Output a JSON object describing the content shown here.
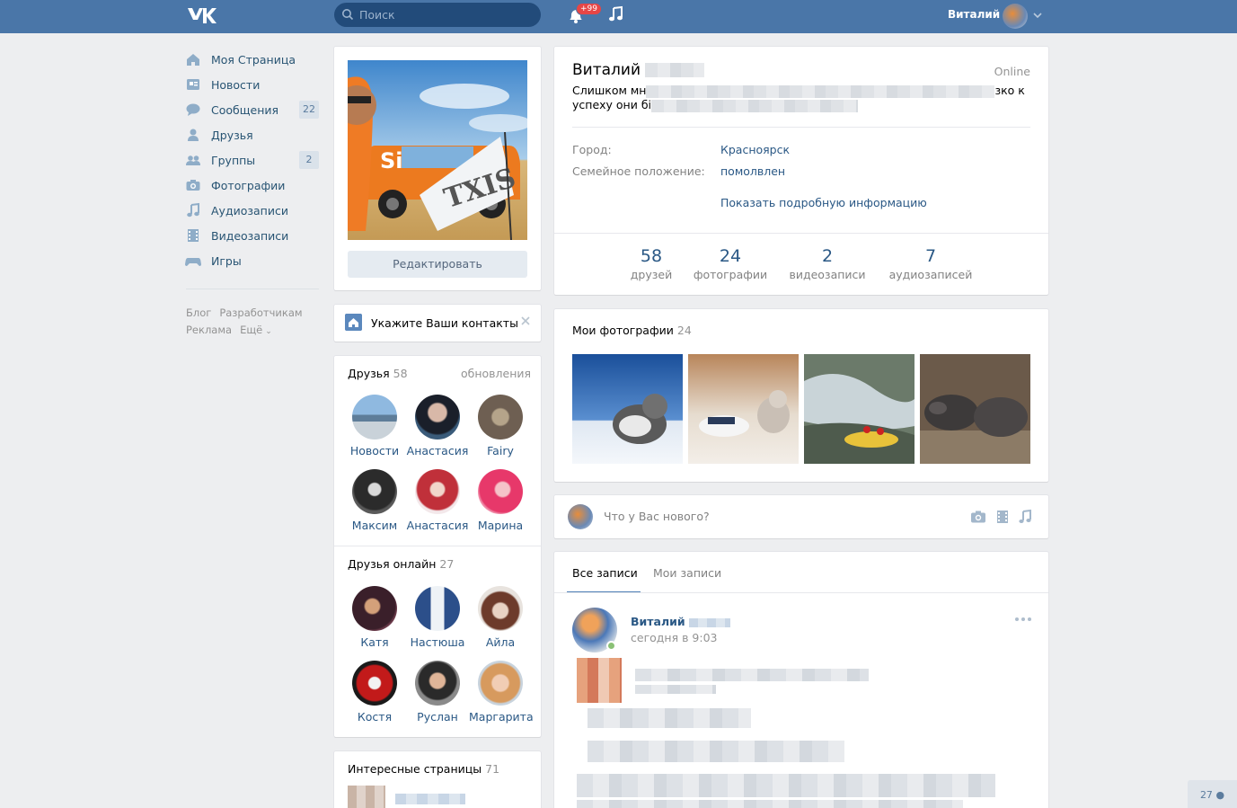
{
  "header": {
    "search_placeholder": "Поиск",
    "notifications_badge": "+99",
    "user_name": "Виталий"
  },
  "sidebar": {
    "items": [
      {
        "label": "Моя Страница",
        "icon": "home-icon",
        "count": ""
      },
      {
        "label": "Новости",
        "icon": "news-icon",
        "count": ""
      },
      {
        "label": "Сообщения",
        "icon": "messages-icon",
        "count": "22"
      },
      {
        "label": "Друзья",
        "icon": "friend-icon",
        "count": ""
      },
      {
        "label": "Группы",
        "icon": "groups-icon",
        "count": "2"
      },
      {
        "label": "Фотографии",
        "icon": "camera-icon",
        "count": ""
      },
      {
        "label": "Аудиозаписи",
        "icon": "music-icon",
        "count": ""
      },
      {
        "label": "Видеозаписи",
        "icon": "film-icon",
        "count": ""
      },
      {
        "label": "Игры",
        "icon": "gamepad-icon",
        "count": ""
      }
    ],
    "footer": [
      "Блог",
      "Разработчикам",
      "Реклама",
      "Ещё"
    ]
  },
  "left_column": {
    "edit_label": "Редактировать",
    "contacts_prompt": "Укажите Ваши контакты",
    "friends": {
      "title": "Друзья",
      "count": "58",
      "updates_label": "обновления",
      "list": [
        "Новости",
        "Анастасия",
        "Fairy",
        "Максим",
        "Анастасия",
        "Марина"
      ]
    },
    "friends_online": {
      "title": "Друзья онлайн",
      "count": "27",
      "list": [
        "Катя",
        "Настюша",
        "Айла",
        "Костя",
        "Руслан",
        "Маргарита"
      ]
    },
    "interesting": {
      "title": "Интересные страницы",
      "count": "71"
    }
  },
  "profile": {
    "name": "Виталий",
    "online_label": "Online",
    "status_line1_start": "Слишком мн",
    "status_line1_end": "зко к",
    "status_line2_start": "успеху они бі",
    "info": [
      {
        "label": "Город:",
        "value": "Красноярск"
      },
      {
        "label": "Семейное положение:",
        "value": "помолвлен"
      }
    ],
    "show_more": "Показать подробную информацию",
    "counters": [
      {
        "num": "58",
        "label": "друзей"
      },
      {
        "num": "24",
        "label": "фотографии"
      },
      {
        "num": "2",
        "label": "видеозаписи"
      },
      {
        "num": "7",
        "label": "аудиозаписей"
      }
    ]
  },
  "photos": {
    "title": "Мои фотографии",
    "count": "24"
  },
  "new_post": {
    "placeholder": "Что у Вас нового?"
  },
  "wall": {
    "tabs": [
      "Все записи",
      "Мои записи"
    ],
    "post_author": "Виталий",
    "post_time": "сегодня в 9:03"
  },
  "corner_badge": "27",
  "colors": {
    "header": "#4a76a8",
    "link": "#2a5885",
    "background": "#edeef0"
  }
}
